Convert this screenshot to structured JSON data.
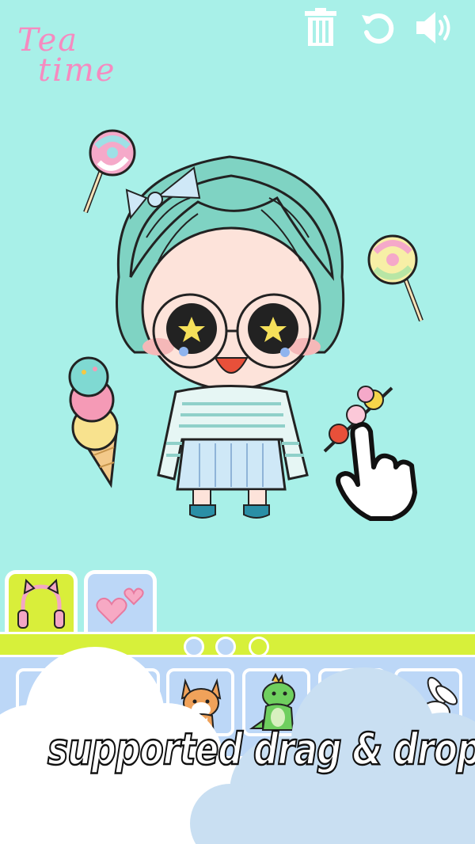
{
  "app": {
    "logo": {
      "line1": "Tea",
      "line2": "time"
    }
  },
  "toolbar": {
    "items": [
      {
        "icon": "trash-icon"
      },
      {
        "icon": "undo-icon"
      },
      {
        "icon": "speaker-icon"
      }
    ]
  },
  "scene": {
    "character": "chibi-girl",
    "stickers": [
      "lollipop-icon",
      "lollipop-icon",
      "ice-cream-icon",
      "candy-skewer-icon"
    ],
    "hint_icon": "pointing-hand-icon"
  },
  "tabs": [
    {
      "icon": "cat-ear-headphones-icon",
      "active": true
    },
    {
      "icon": "hearts-icon",
      "active": false
    }
  ],
  "pager": {
    "pages": 3,
    "current": 2
  },
  "tray_items": [
    "empty",
    "empty",
    "corgi-icon",
    "dinosaur-icon",
    "empty",
    "bunny-icon"
  ],
  "caption": "supported drag & drop!",
  "colors": {
    "background": "#a8f0e8",
    "accent_lime": "#d7f03a",
    "tray_blue": "#bcd7f7",
    "logo_pink": "#f58bc0"
  }
}
